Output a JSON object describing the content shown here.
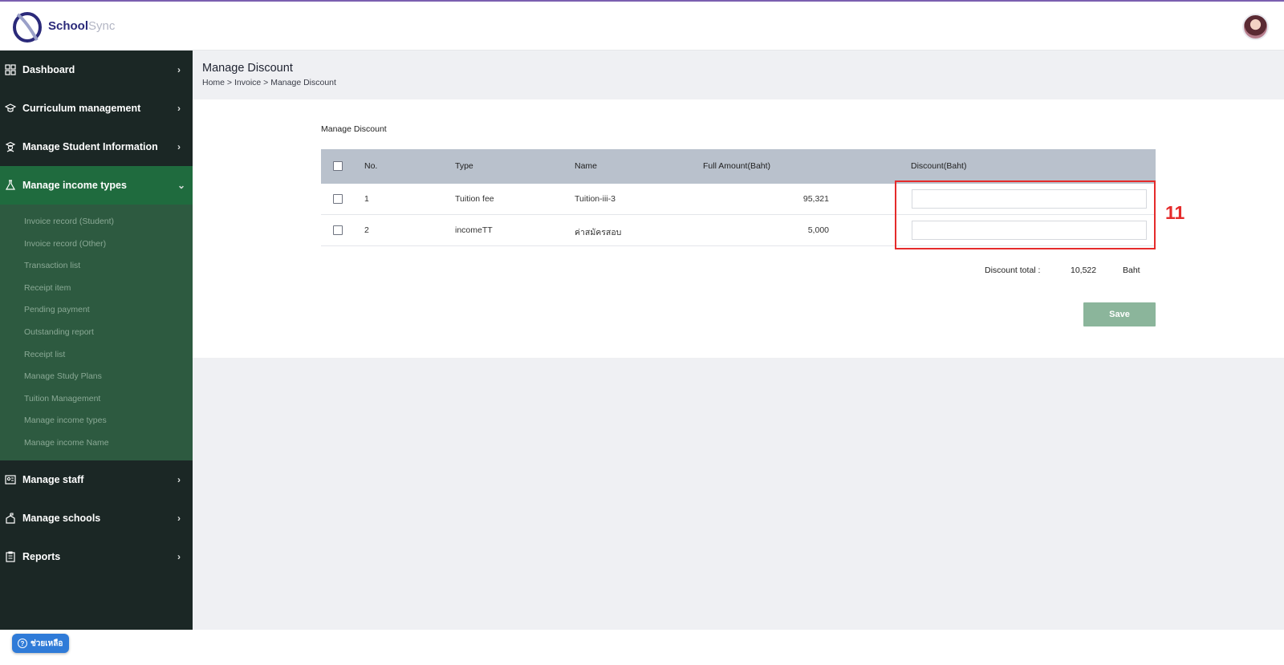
{
  "app": {
    "name_part1": "School",
    "name_part2": "Sync"
  },
  "sidebar": {
    "items": [
      {
        "label": "Dashboard",
        "icon": "dashboard-icon",
        "chevron": "›"
      },
      {
        "label": "Curriculum management",
        "icon": "graduation-cap-icon",
        "chevron": "›"
      },
      {
        "label": "Manage Student Information",
        "icon": "student-icon",
        "chevron": "›"
      },
      {
        "label": "Manage income types",
        "icon": "flask-icon",
        "chevron": "⌄"
      },
      {
        "label": "Manage staff",
        "icon": "staff-id-icon",
        "chevron": "›"
      },
      {
        "label": "Manage schools",
        "icon": "school-icon",
        "chevron": "›"
      },
      {
        "label": "Reports",
        "icon": "clipboard-icon",
        "chevron": "›"
      }
    ],
    "submenu": [
      "Invoice record (Student)",
      "Invoice record (Other)",
      "Transaction list",
      "Receipt item",
      "Pending payment",
      "Outstanding report",
      "Receipt list",
      "Manage Study Plans",
      "Tuition Management",
      "Manage income types",
      "Manage income Name"
    ]
  },
  "page": {
    "title": "Manage Discount",
    "breadcrumb": "Home > Invoice > Manage Discount",
    "card_title": "Manage Discount"
  },
  "table": {
    "headers": {
      "no": "No.",
      "type": "Type",
      "name": "Name",
      "full_amount": "Full Amount(Baht)",
      "discount": "Discount(Baht)"
    },
    "rows": [
      {
        "no": "1",
        "type": "Tuition fee",
        "name": "Tuition-iii-3",
        "full_amount": "95,321",
        "discount": ""
      },
      {
        "no": "2",
        "type": "incomeTT",
        "name": "ค่าสมัครสอบ",
        "full_amount": "5,000",
        "discount": ""
      }
    ]
  },
  "summary": {
    "label": "Discount total :",
    "value": "10,522",
    "unit": "Baht"
  },
  "actions": {
    "save": "Save"
  },
  "annotation": {
    "label": "11",
    "color": "#e52b2b"
  },
  "help": {
    "label": "ช่วยเหลือ",
    "icon": "question-icon"
  },
  "colors": {
    "sidebar_bg": "#1b2725",
    "active_bg": "#1f6b3e",
    "submenu_bg": "#2d5a40",
    "save_bg": "#8bb59b",
    "accent_top": "#7b5fb0"
  }
}
